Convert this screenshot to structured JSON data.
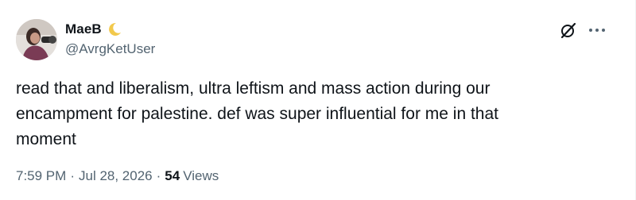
{
  "author": {
    "display_name": "MaeB",
    "handle": "@AvrgKetUser",
    "name_emoji": "crescent-moon-icon"
  },
  "post": {
    "text": "read that and liberalism, ultra leftism and mass action during our\nencampment for palestine. def was super influential for me in that\nmoment",
    "time": "7:59 PM",
    "date": "Jul 28, 2026",
    "separator": "·",
    "views_count": "54",
    "views_label": "Views"
  },
  "actions": {
    "grok_icon": "grok-icon",
    "more_icon": "more-options-icon"
  },
  "colors": {
    "text_primary": "#0f1419",
    "text_secondary": "#536471",
    "background": "#ffffff"
  }
}
